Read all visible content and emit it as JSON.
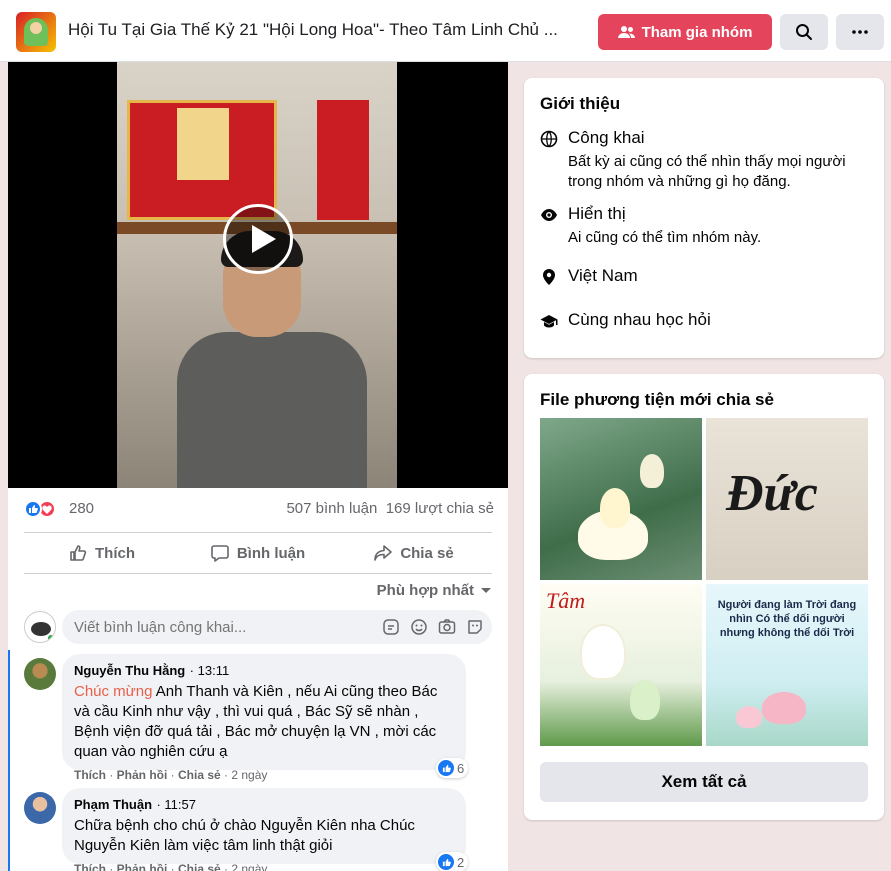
{
  "header": {
    "group_title": "Hội Tu Tại Gia Thế Kỷ 21 \"Hội Long Hoa\"- Theo Tâm Linh Chủ ...",
    "join_label": "Tham gia nhóm",
    "accent_color": "#e4445c"
  },
  "post": {
    "reaction_count": "280",
    "comment_count": "507 bình luận",
    "share_count": "169 lượt chia sẻ",
    "actions": {
      "like": "Thích",
      "comment": "Bình luận",
      "share": "Chia sẻ"
    },
    "sort_label": "Phù hợp nhất",
    "comment_placeholder": "Viết bình luận công khai..."
  },
  "comments": [
    {
      "name": "Nguyễn Thu Hằng",
      "time": "13:11",
      "highlight": "Chúc mừng",
      "text": " Anh Thanh và Kiên , nếu Ai cũng theo Bác và cầu Kinh như vậy , thì vui quá , Bác Sỹ sẽ nhàn , Bệnh viện đỡ quá tải , Bác mở chuyện lạ VN , mời các quan vào nghiên cứu ạ",
      "like": "Thích",
      "reply": "Phản hồi",
      "share": "Chia sẻ",
      "age": "2 ngày",
      "likes": "6"
    },
    {
      "name": "Phạm Thuận",
      "time": "11:57",
      "text": "Chữa bệnh cho chú ở chào Nguyễn Kiên nha Chúc Nguyễn Kiên làm việc tâm linh thật giỏi",
      "like": "Thích",
      "reply": "Phản hồi",
      "share": "Chia sẻ",
      "age": "2 ngày",
      "likes": "2"
    }
  ],
  "about": {
    "title": "Giới thiệu",
    "items": [
      {
        "icon": "globe-icon",
        "label": "Công khai",
        "desc": "Bất kỳ ai cũng có thể nhìn thấy mọi người trong nhóm và những gì họ đăng."
      },
      {
        "icon": "eye-icon",
        "label": "Hiển thị",
        "desc": "Ai cũng có thể tìm nhóm này."
      },
      {
        "icon": "location-pin-icon",
        "label": "Việt Nam"
      },
      {
        "icon": "graduation-cap-icon",
        "label": "Cùng nhau học hỏi"
      }
    ]
  },
  "media": {
    "title": "File phương tiện mới chia sẻ",
    "see_all": "Xem tất cả",
    "tiles": [
      {
        "caption": ""
      },
      {
        "caption": "Đức"
      },
      {
        "caption": "Tâm"
      },
      {
        "caption": "Người đang làm Trời đang nhìn Có thể dối người nhưng không thể dối Trời"
      }
    ]
  }
}
